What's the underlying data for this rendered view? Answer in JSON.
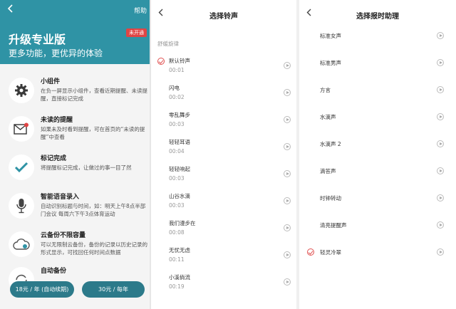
{
  "upgrade": {
    "back_icon": "chevron-left-icon",
    "help": "帮助",
    "title": "升级专业版",
    "subtitle": "更多功能，更优异的体验",
    "badge": "未开通",
    "features": [
      {
        "icon": "gear-icon",
        "title": "小组件",
        "desc": "在负一屏显示小组件，查看近期提醒、未读提醒，直接标记完成"
      },
      {
        "icon": "envelope-alert-icon",
        "title": "未读的提醒",
        "desc": "如果未及时看到提醒，可在首页的“未读的提醒”中查看"
      },
      {
        "icon": "checkmark-icon",
        "title": "标记完成",
        "desc": "将提醒标记完成，让做过的事一目了然"
      },
      {
        "icon": "microphone-icon",
        "title": "智能语音录入",
        "desc": "自动识别标题与时间，如：明天上午8点半部门会议 每周六下午3点体育运动"
      },
      {
        "icon": "cloud-icon",
        "title": "云备份不限容量",
        "desc": "可以无限制云备份，备份的记录以历史记录的形式显示，可找回任何时间点数据"
      },
      {
        "icon": "sync-icon",
        "title": "自动备份",
        "desc": ""
      }
    ],
    "buttons": [
      "18元 / 年 (自动续期)",
      "30元 / 每年"
    ],
    "accent": "#2f93a5",
    "button_color": "#2c7a8a",
    "badge_color": "#e04545"
  },
  "ringtone": {
    "title": "选择铃声",
    "back_icon": "chevron-left-icon",
    "section": "舒缓旋律",
    "selected_index": 0,
    "items": [
      {
        "name": "默认铃声",
        "duration": "00:01"
      },
      {
        "name": "闪电",
        "duration": "00:02"
      },
      {
        "name": "零乱舞步",
        "duration": "00:03"
      },
      {
        "name": "轻轻耳语",
        "duration": "00:04"
      },
      {
        "name": "轻轻响起",
        "duration": "00:03"
      },
      {
        "name": "山谷水滴",
        "duration": "00:03"
      },
      {
        "name": "我们漫步在",
        "duration": "00:08"
      },
      {
        "name": "无忧无虑",
        "duration": "00:11"
      },
      {
        "name": "小溪倘流",
        "duration": "00:19"
      }
    ]
  },
  "assistant": {
    "title": "选择报时助理",
    "back_icon": "chevron-left-icon",
    "selected_index": 8,
    "items": [
      "标准女声",
      "标准男声",
      "方言",
      "水滴声",
      "水滴声 2",
      "滴答声",
      "时钟转动",
      "清亮提醒声",
      "轻灵冷翠"
    ]
  }
}
